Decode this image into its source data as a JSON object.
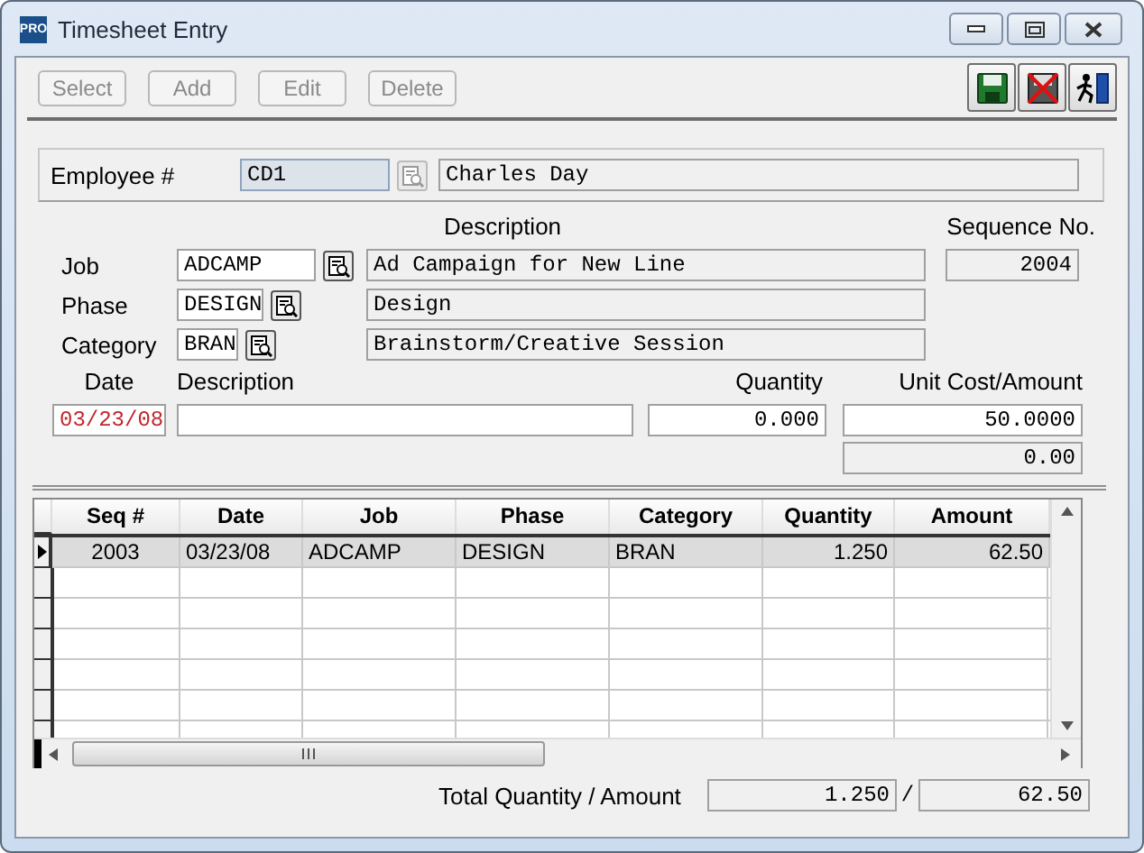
{
  "window": {
    "logo": "PRO",
    "title": "Timesheet Entry"
  },
  "toolbar": {
    "buttons": [
      {
        "label": "Select",
        "disabled": true
      },
      {
        "label": "Add",
        "disabled": true
      },
      {
        "label": "Edit",
        "disabled": true
      },
      {
        "label": "Delete",
        "disabled": true
      }
    ]
  },
  "employee": {
    "label": "Employee #",
    "number": "CD1",
    "name": "Charles Day"
  },
  "headers": {
    "description": "Description",
    "sequence": "Sequence No."
  },
  "codes": [
    {
      "label": "Job",
      "code": "ADCAMP",
      "description": "Ad Campaign for New Line"
    },
    {
      "label": "Phase",
      "code": "DESIGN",
      "description": "Design"
    },
    {
      "label": "Category",
      "code": "BRAN",
      "description": "Brainstorm/Creative Session"
    }
  ],
  "sequence_no": "2004",
  "entry": {
    "headers": [
      "Date",
      "Description",
      "Quantity",
      "Unit Cost/Amount"
    ],
    "date": "03/23/08",
    "quantity": "0.000",
    "unit_cost": "50.0000",
    "amount": "0.00"
  },
  "grid": {
    "columns": [
      "Seq #",
      "Date",
      "Job",
      "Phase",
      "Category",
      "Quantity",
      "Amount"
    ],
    "rows": [
      {
        "selected": true,
        "cells": [
          "2003",
          "03/23/08",
          "ADCAMP",
          "DESIGN",
          "BRAN",
          "1.250",
          "62.50"
        ]
      }
    ]
  },
  "totals": {
    "label": "Total Quantity / Amount",
    "quantity": "1.250",
    "separator": "/",
    "amount": "62.50"
  }
}
